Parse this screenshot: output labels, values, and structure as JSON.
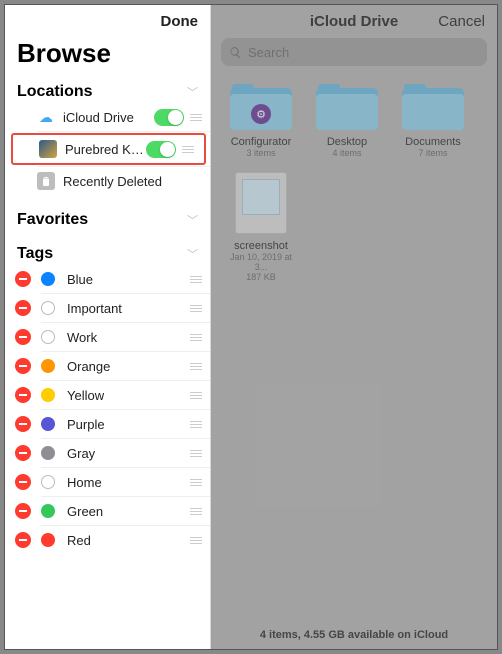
{
  "sidebar": {
    "done": "Done",
    "title": "Browse",
    "sections": {
      "locations": {
        "header": "Locations",
        "items": [
          {
            "label": "iCloud Drive",
            "toggle": true
          },
          {
            "label": "Purebred Ke...",
            "toggle": true
          },
          {
            "label": "Recently Deleted",
            "toggle": false
          }
        ]
      },
      "favorites": {
        "header": "Favorites"
      },
      "tags": {
        "header": "Tags",
        "items": [
          {
            "label": "Blue",
            "color": "#0a84ff",
            "filled": true
          },
          {
            "label": "Important",
            "color": null,
            "filled": false
          },
          {
            "label": "Work",
            "color": null,
            "filled": false
          },
          {
            "label": "Orange",
            "color": "#ff9500",
            "filled": true
          },
          {
            "label": "Yellow",
            "color": "#ffcc00",
            "filled": true
          },
          {
            "label": "Purple",
            "color": "#5856d6",
            "filled": true
          },
          {
            "label": "Gray",
            "color": "#8e8e93",
            "filled": true
          },
          {
            "label": "Home",
            "color": null,
            "filled": false
          },
          {
            "label": "Green",
            "color": "#34c759",
            "filled": true
          },
          {
            "label": "Red",
            "color": "#ff3b30",
            "filled": true
          }
        ]
      }
    }
  },
  "main": {
    "title": "iCloud Drive",
    "cancel": "Cancel",
    "search_placeholder": "Search",
    "items": [
      {
        "name": "Configurator",
        "meta": "3 items",
        "type": "folder",
        "badge_bg": "#6a3d9a",
        "badge_txt": "⚙"
      },
      {
        "name": "Desktop",
        "meta": "4 items",
        "type": "folder",
        "badge_bg": null,
        "badge_txt": ""
      },
      {
        "name": "Documents",
        "meta": "7 items",
        "type": "folder",
        "badge_bg": null,
        "badge_txt": ""
      },
      {
        "name": "screenshot",
        "meta": "Jan 10, 2019 at 3...",
        "meta2": "187 KB",
        "type": "file"
      }
    ],
    "footer": "4 items, 4.55 GB available on iCloud"
  }
}
